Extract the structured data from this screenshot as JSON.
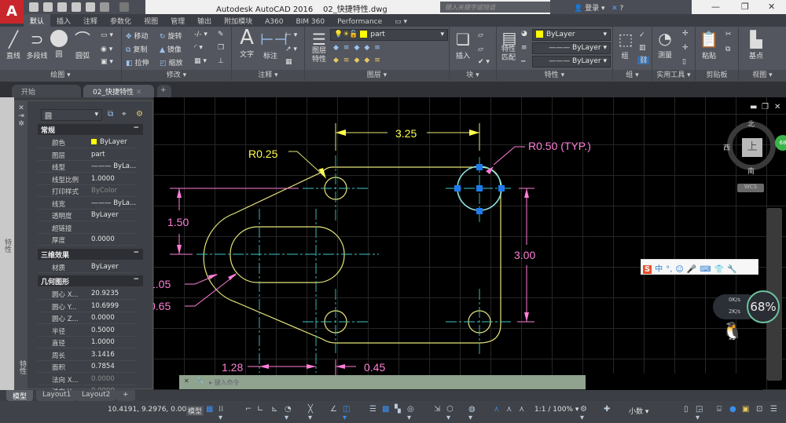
{
  "app": {
    "title": "Autodesk AutoCAD 2016",
    "file": "02_快捷特性.dwg",
    "logo": "A",
    "search_placeholder": "键入关键字或短语",
    "login": "登录"
  },
  "ribbon_tabs": [
    "默认",
    "插入",
    "注释",
    "参数化",
    "视图",
    "管理",
    "输出",
    "附加模块",
    "A360",
    "BIM 360",
    "Performance"
  ],
  "panels": {
    "draw": {
      "label": "绘图 ▾",
      "line": "直线",
      "polyline": "多段线",
      "circle": "圆",
      "arc": "圆弧"
    },
    "modify": {
      "label": "修改 ▾",
      "move": "移动",
      "rotate": "旋转",
      "copy": "复制",
      "mirror": "镜像",
      "stretch": "拉伸",
      "scale": "缩放"
    },
    "annotation": {
      "label": "注释 ▾",
      "text": "文字",
      "dimension": "标注"
    },
    "layers": {
      "label": "图层 ▾",
      "props": "图层\n特性",
      "current": "part"
    },
    "block": {
      "label": "块 ▾",
      "insert": "插入"
    },
    "properties": {
      "label": "特性 ▾",
      "match": "特性\n匹配",
      "color": "ByLayer",
      "linetype": "ByLayer",
      "lineweight": "ByLayer"
    },
    "groups": {
      "label": "组 ▾",
      "group": "组"
    },
    "utilities": {
      "label": "实用工具 ▾",
      "measure": "测量"
    },
    "clipboard": {
      "label": "剪贴板",
      "paste": "粘贴"
    },
    "view": {
      "label": "视图 ▾",
      "basepoint": "基点"
    }
  },
  "file_tabs": [
    "开始",
    "02_快捷特性"
  ],
  "palette": {
    "side_label": "特性",
    "object_type": "圆",
    "sections": [
      {
        "title": "常规",
        "rows": [
          [
            "颜色",
            "ByLayer"
          ],
          [
            "图层",
            "part"
          ],
          [
            "线型",
            "——— ByLa..."
          ],
          [
            "线型比例",
            "1.0000"
          ],
          [
            "打印样式",
            "ByColor"
          ],
          [
            "线宽",
            "——— ByLa..."
          ],
          [
            "透明度",
            "ByLayer"
          ],
          [
            "超链接",
            ""
          ],
          [
            "厚度",
            "0.0000"
          ]
        ]
      },
      {
        "title": "三维效果",
        "rows": [
          [
            "材质",
            "ByLayer"
          ]
        ]
      },
      {
        "title": "几何图形",
        "rows": [
          [
            "圆心 X...",
            "20.9235"
          ],
          [
            "圆心 Y...",
            "10.6999"
          ],
          [
            "圆心 Z...",
            "0.0000"
          ],
          [
            "半径",
            "0.5000"
          ],
          [
            "直径",
            "1.0000"
          ],
          [
            "周长",
            "3.1416"
          ],
          [
            "面积",
            "0.7854"
          ],
          [
            "法向 X...",
            "0.0000"
          ],
          [
            "法向 Y...",
            "0.0000"
          ]
        ]
      }
    ]
  },
  "drawing": {
    "dims": {
      "top": "3.25",
      "r_small": "R0.25",
      "r_typ": "R0.50 (TYP.)",
      "left_v": "1.50",
      "right_v": "3.00",
      "d1": "1.05",
      "d2": "0.65",
      "bottom_l": "1.28",
      "bottom_r": "0.45"
    },
    "colors": {
      "outline": "#e6e67a",
      "center": "#3ec8c8",
      "dim_pink": "#ff7fd8",
      "dim_yellow": "#ffff4d",
      "grip": "#1e7cf0"
    }
  },
  "viewcube": {
    "north": "北",
    "south": "南",
    "west": "西",
    "east": "东",
    "face": "上",
    "wcs": "WCS"
  },
  "command": {
    "placeholder": "键入命令"
  },
  "layout_tabs": [
    "模型",
    "Layout1",
    "Layout2",
    "+"
  ],
  "status": {
    "coords": "10.4191, 9.2976, 0.0000",
    "space": "模型",
    "scale": "1:1 / 100%",
    "units": "小数"
  },
  "overlays": {
    "ime": [
      "S",
      "中",
      "°,",
      "☺",
      "🎤",
      "⌨",
      "👕",
      "🔧"
    ],
    "net_up": "0K/s",
    "net_down": "2K/s",
    "cpu": "68%",
    "ball": "68"
  }
}
